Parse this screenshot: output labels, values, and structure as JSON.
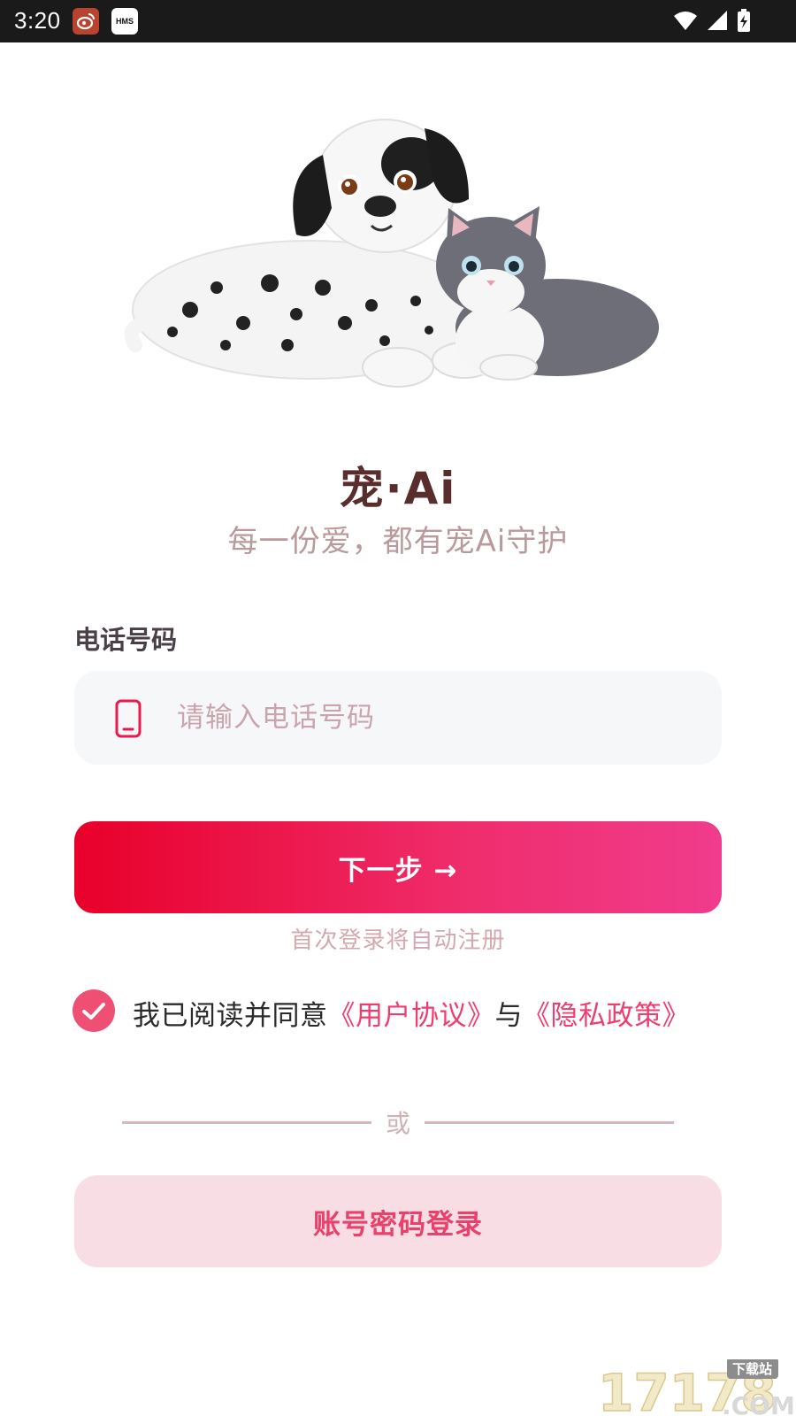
{
  "status_bar": {
    "time": "3:20",
    "hms_label": "HMS",
    "icons": [
      "weibo-app-icon",
      "hms-icon",
      "wifi-icon",
      "signal-icon",
      "battery-charging-icon"
    ]
  },
  "hero": {
    "image": "dalmatian-puppy-and-gray-cat-illustration"
  },
  "header": {
    "title": "宠·Ai",
    "subtitle": "每一份爱，都有宠Ai守护"
  },
  "phone": {
    "label": "电话号码",
    "placeholder": "请输入电话号码",
    "value": "",
    "icon": "smartphone-icon"
  },
  "actions": {
    "next_label": "下一步 →",
    "auto_register_hint": "首次登录将自动注册",
    "divider_label": "或",
    "password_login_label": "账号密码登录"
  },
  "agreement": {
    "checked": true,
    "prefix": "我已阅读并同意",
    "user_agreement_link": "《用户协议》",
    "connector": "与",
    "privacy_policy_link": "《隐私政策》"
  },
  "watermark": {
    "text": "17178",
    "sub": "下载站",
    "domain": ".COM"
  },
  "colors": {
    "accent": "#ee3d6f",
    "button_gradient_start": "#e8002a",
    "button_gradient_end": "#f03c8c",
    "secondary_button_bg": "#f8dde4",
    "title": "#5a2d2d",
    "subtitle": "#b9999c"
  }
}
